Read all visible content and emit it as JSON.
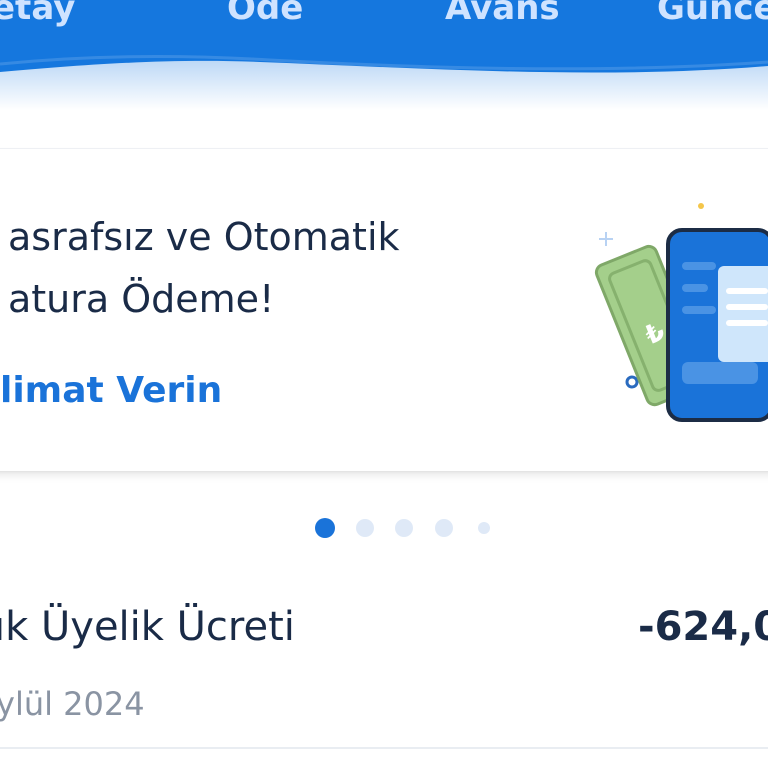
{
  "tabs": [
    {
      "label": "etay"
    },
    {
      "label": "Öde"
    },
    {
      "label": "Avans"
    },
    {
      "label": "Günce"
    }
  ],
  "promo": {
    "title_line1": "asrafsız ve Otomatik",
    "title_line2": "atura Ödeme!",
    "link_label": "limat Verin",
    "illustration_icon": "phone-with-banknote-icon"
  },
  "pager": {
    "total": 5,
    "active_index": 0
  },
  "transaction": {
    "title": "ık Üyelik Ücreti",
    "amount": "-624,0",
    "date": "ylül 2024"
  },
  "colors": {
    "brand_blue": "#1a73d9",
    "top_bar_blue": "#1577de",
    "text_dark": "#1a2b47",
    "text_muted": "#8a94a3",
    "dot_inactive": "#dfe9f7",
    "banknote_green": "#9cc783"
  }
}
